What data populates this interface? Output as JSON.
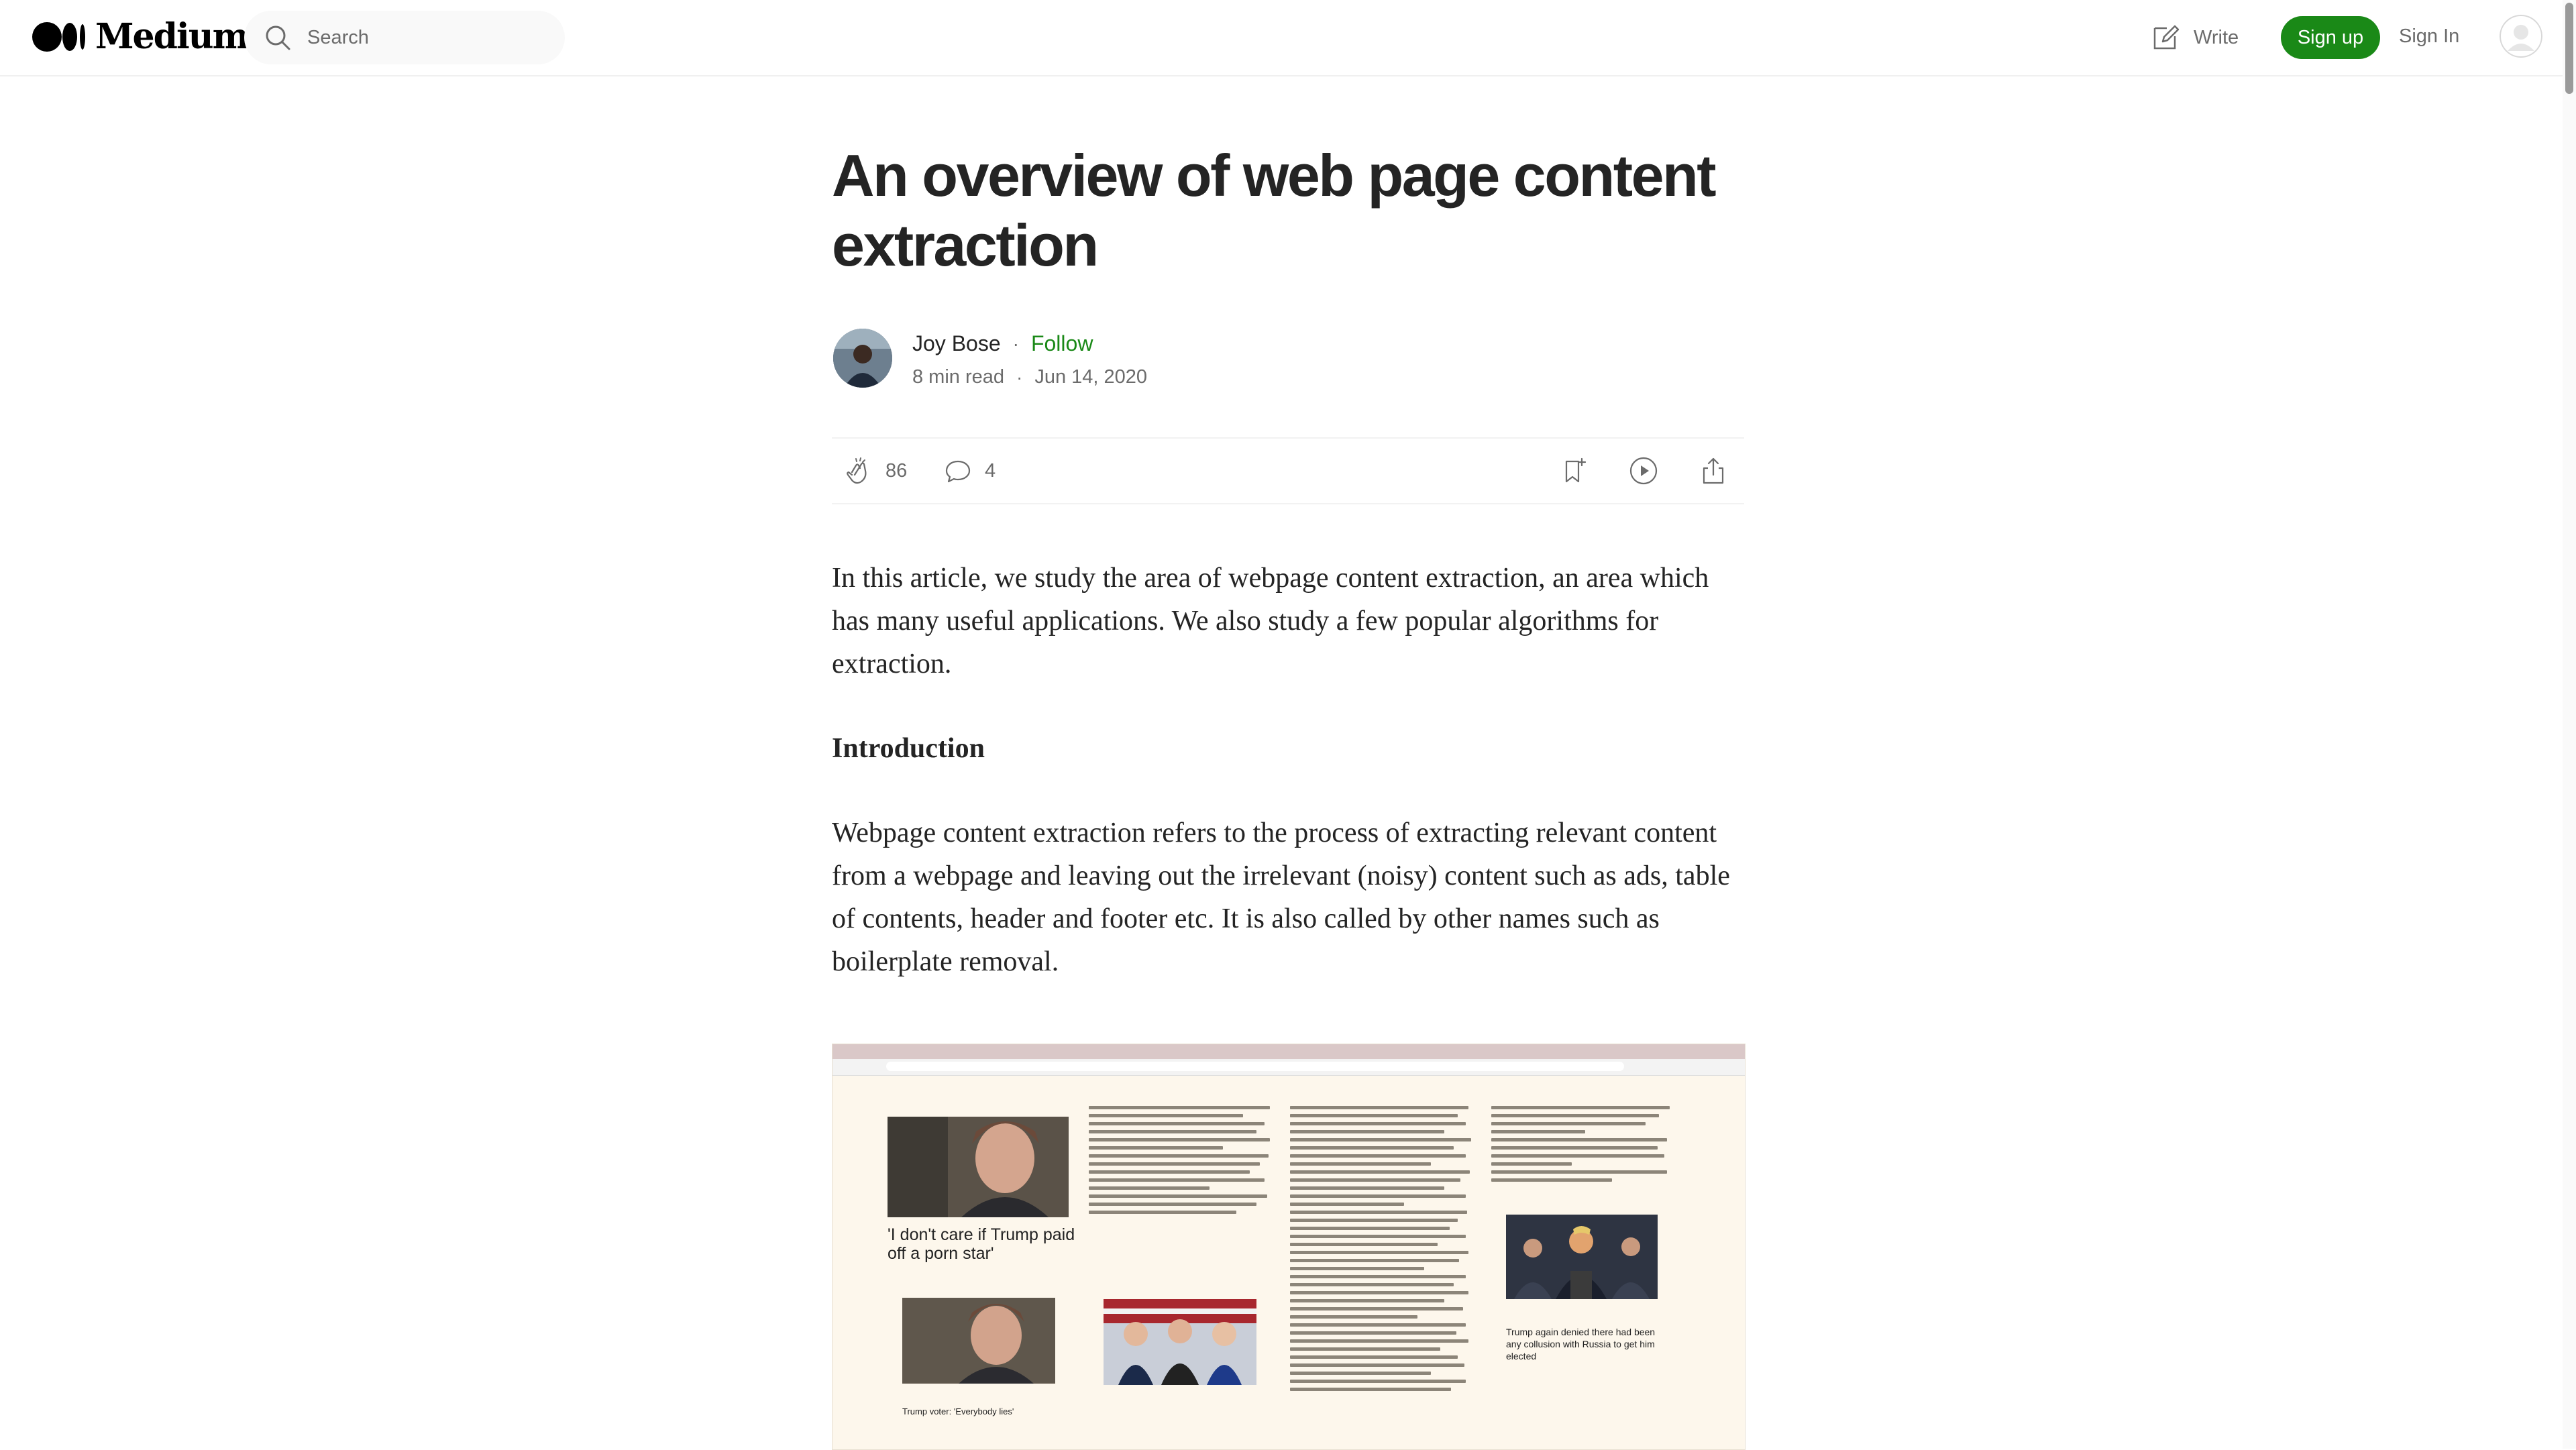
{
  "header": {
    "logo_text": "Medium",
    "search_placeholder": "Search",
    "write_label": "Write",
    "signup_label": "Sign up",
    "signin_label": "Sign In"
  },
  "article": {
    "title": "An overview of web page content extraction",
    "author": "Joy Bose",
    "follow_label": "Follow",
    "read_time": "8 min read",
    "date": "Jun 14, 2020",
    "claps": "86",
    "responses": "4",
    "paragraph_1": "In this article, we study the area of webpage content extraction, an area which has many useful applications. We also study a few popular algorithms for extraction.",
    "heading_intro": "Introduction",
    "paragraph_2": "Webpage content extraction refers to the process of extracting relevant content from a webpage and leaving out the irrelevant (noisy) content such as ads, table of contents, header and footer etc. It is also called by other names such as boilerplate removal."
  },
  "figure": {
    "caption_left": "'I don't care if Trump paid off a porn star'",
    "caption_small": "Trump voter: 'Everybody lies'",
    "caption_right": "Trump again denied there had been any collusion with Russia to get him elected"
  },
  "colors": {
    "accent_green": "#1a8917",
    "text_primary": "#242424",
    "text_secondary": "#6b6b6b"
  },
  "icons": {
    "logo": "medium-logo-icon",
    "search": "search-icon",
    "write": "write-icon",
    "clap": "clap-icon",
    "response": "response-icon",
    "bookmark": "bookmark-icon",
    "listen": "play-icon",
    "share": "share-icon"
  }
}
